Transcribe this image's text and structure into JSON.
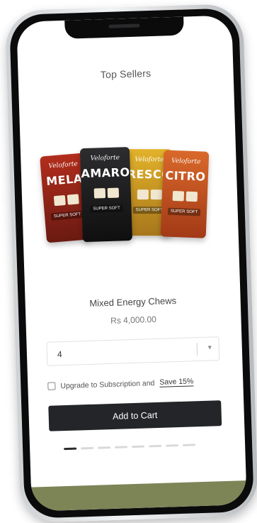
{
  "page": {
    "title": "Top Sellers"
  },
  "product": {
    "name": "Mixed Energy Chews",
    "price": "Rs 4,000.00",
    "packs": [
      {
        "brand": "Veloforte",
        "flavor": "MELA"
      },
      {
        "brand": "Veloforte",
        "flavor": "AMARO"
      },
      {
        "brand": "Veloforte",
        "flavor": "RESCO"
      },
      {
        "brand": "Veloforte",
        "flavor": "CITRO"
      }
    ],
    "pack_badge": "SUPER SOFT"
  },
  "quantity": {
    "value": "4"
  },
  "subscription": {
    "label": "Upgrade to Subscription and",
    "save_label": "Save 15%"
  },
  "cart": {
    "label": "Add to Cart"
  },
  "carousel": {
    "count": 8,
    "active_index": 0
  },
  "colors": {
    "band": "#7d8456",
    "button": "#232528"
  }
}
